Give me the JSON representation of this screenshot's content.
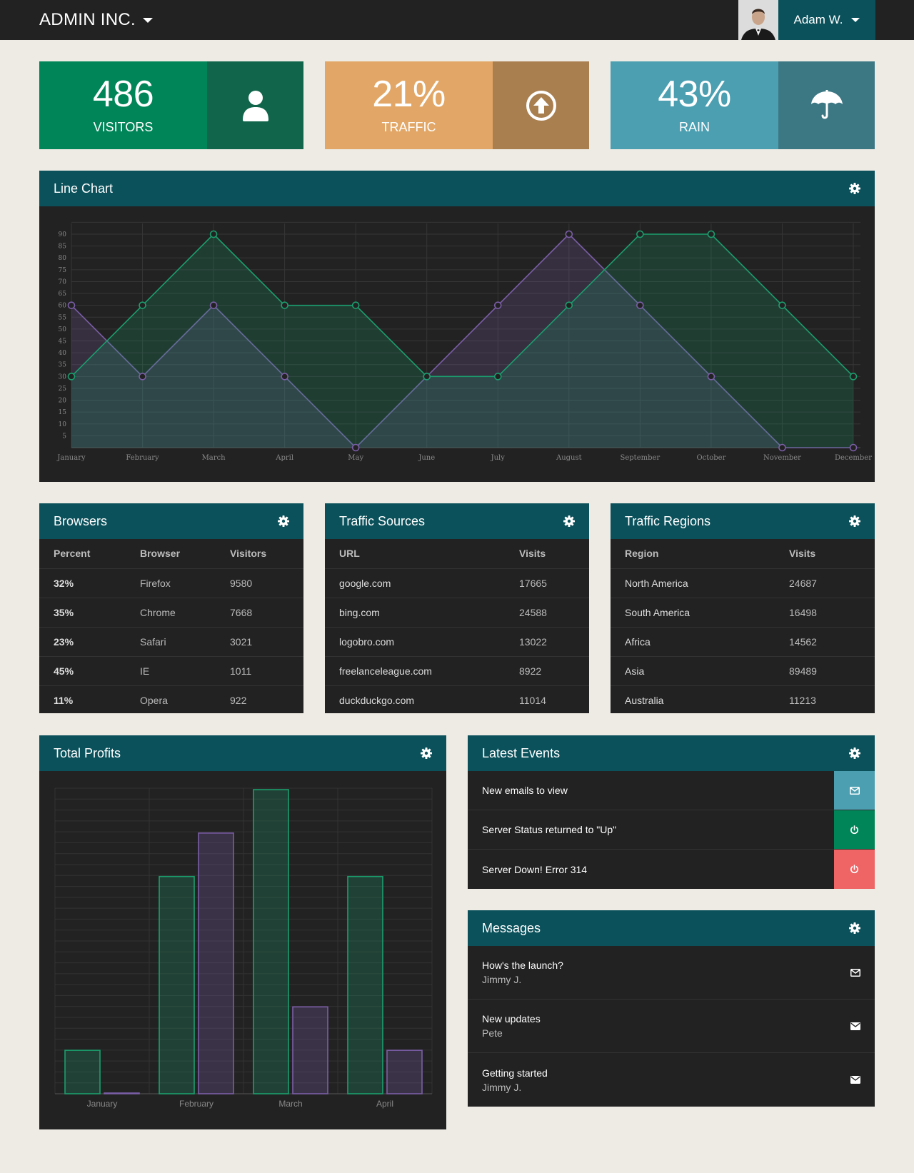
{
  "header": {
    "brand": "ADMIN INC.",
    "user_name": "Adam W."
  },
  "stats": [
    {
      "value": "486",
      "label": "VISITORS",
      "icon": "user-icon",
      "color": "#008558",
      "icon_bg": "#10654a"
    },
    {
      "value": "21%",
      "label": "TRAFFIC",
      "icon": "arrow-up-circle-icon",
      "color": "#e2a766",
      "icon_bg": "#a97f50"
    },
    {
      "value": "43%",
      "label": "RAIN",
      "icon": "umbrella-icon",
      "color": "#4b9fb1",
      "icon_bg": "#3c7884"
    }
  ],
  "line_panel": {
    "title": "Line Chart"
  },
  "browsers": {
    "title": "Browsers",
    "headers": [
      "Percent",
      "Browser",
      "Visitors"
    ],
    "rows": [
      [
        "32%",
        "Firefox",
        "9580"
      ],
      [
        "35%",
        "Chrome",
        "7668"
      ],
      [
        "23%",
        "Safari",
        "3021"
      ],
      [
        "45%",
        "IE",
        "1011"
      ],
      [
        "11%",
        "Opera",
        "922"
      ]
    ]
  },
  "traffic_sources": {
    "title": "Traffic Sources",
    "headers": [
      "URL",
      "Visits"
    ],
    "rows": [
      [
        "google.com",
        "17665"
      ],
      [
        "bing.com",
        "24588"
      ],
      [
        "logobro.com",
        "13022"
      ],
      [
        "freelanceleague.com",
        "8922"
      ],
      [
        "duckduckgo.com",
        "11014"
      ]
    ]
  },
  "traffic_regions": {
    "title": "Traffic Regions",
    "headers": [
      "Region",
      "Visits"
    ],
    "rows": [
      [
        "North America",
        "24687"
      ],
      [
        "South America",
        "16498"
      ],
      [
        "Africa",
        "14562"
      ],
      [
        "Asia",
        "89489"
      ],
      [
        "Australia",
        "11213"
      ]
    ]
  },
  "profits_panel": {
    "title": "Total Profits"
  },
  "events": {
    "title": "Latest Events",
    "items": [
      {
        "text": "New emails to view",
        "icon": "envelope-icon",
        "color": "#4b9fb1"
      },
      {
        "text": "Server Status returned to \"Up\"",
        "icon": "power-icon",
        "color": "#008558"
      },
      {
        "text": "Server Down! Error 314",
        "icon": "power-icon",
        "color": "#ef6464"
      }
    ]
  },
  "messages": {
    "title": "Messages",
    "items": [
      {
        "title": "How's the launch?",
        "from": "Jimmy J.",
        "icon": "envelope-outline-icon"
      },
      {
        "title": "New updates",
        "from": "Pete",
        "icon": "envelope-icon"
      },
      {
        "title": "Getting started",
        "from": "Jimmy J.",
        "icon": "envelope-icon"
      }
    ]
  },
  "chart_data": [
    {
      "type": "area",
      "categories": [
        "January",
        "February",
        "March",
        "April",
        "May",
        "June",
        "July",
        "August",
        "September",
        "October",
        "November",
        "December"
      ],
      "series": [
        {
          "values": [
            60,
            30,
            60,
            30,
            0,
            30,
            60,
            90,
            60,
            30,
            0,
            0
          ],
          "color": "#7b5ea7"
        },
        {
          "values": [
            30,
            60,
            90,
            60,
            60,
            30,
            30,
            60,
            90,
            90,
            60,
            30
          ],
          "color": "#1b9e6e"
        }
      ],
      "yticks": [
        5,
        10,
        15,
        20,
        25,
        30,
        35,
        40,
        45,
        50,
        55,
        60,
        65,
        70,
        75,
        80,
        85,
        90
      ],
      "ylim": [
        0,
        90
      ],
      "grid": true
    },
    {
      "type": "bar",
      "categories": [
        "January",
        "February",
        "March",
        "April"
      ],
      "series": [
        {
          "values": [
            10,
            50,
            70,
            50
          ],
          "color": "#1b9e6e"
        },
        {
          "values": [
            0,
            60,
            20,
            10
          ],
          "color": "#7b5ea7"
        }
      ],
      "ylim": [
        0,
        70
      ],
      "grid": true
    }
  ]
}
